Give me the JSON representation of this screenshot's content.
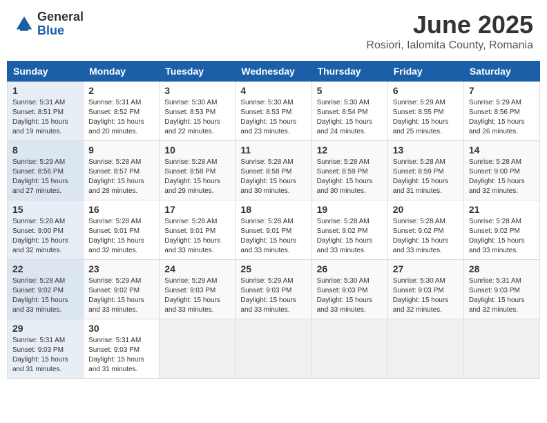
{
  "logo": {
    "general": "General",
    "blue": "Blue"
  },
  "title": "June 2025",
  "location": "Rosiori, Ialomita County, Romania",
  "weekdays": [
    "Sunday",
    "Monday",
    "Tuesday",
    "Wednesday",
    "Thursday",
    "Friday",
    "Saturday"
  ],
  "weeks": [
    [
      {
        "day": "1",
        "sunrise": "5:31 AM",
        "sunset": "8:51 PM",
        "daylight": "15 hours and 19 minutes."
      },
      {
        "day": "2",
        "sunrise": "5:31 AM",
        "sunset": "8:52 PM",
        "daylight": "15 hours and 20 minutes."
      },
      {
        "day": "3",
        "sunrise": "5:30 AM",
        "sunset": "8:53 PM",
        "daylight": "15 hours and 22 minutes."
      },
      {
        "day": "4",
        "sunrise": "5:30 AM",
        "sunset": "8:53 PM",
        "daylight": "15 hours and 23 minutes."
      },
      {
        "day": "5",
        "sunrise": "5:30 AM",
        "sunset": "8:54 PM",
        "daylight": "15 hours and 24 minutes."
      },
      {
        "day": "6",
        "sunrise": "5:29 AM",
        "sunset": "8:55 PM",
        "daylight": "15 hours and 25 minutes."
      },
      {
        "day": "7",
        "sunrise": "5:29 AM",
        "sunset": "8:56 PM",
        "daylight": "15 hours and 26 minutes."
      }
    ],
    [
      {
        "day": "8",
        "sunrise": "5:29 AM",
        "sunset": "8:56 PM",
        "daylight": "15 hours and 27 minutes."
      },
      {
        "day": "9",
        "sunrise": "5:28 AM",
        "sunset": "8:57 PM",
        "daylight": "15 hours and 28 minutes."
      },
      {
        "day": "10",
        "sunrise": "5:28 AM",
        "sunset": "8:58 PM",
        "daylight": "15 hours and 29 minutes."
      },
      {
        "day": "11",
        "sunrise": "5:28 AM",
        "sunset": "8:58 PM",
        "daylight": "15 hours and 30 minutes."
      },
      {
        "day": "12",
        "sunrise": "5:28 AM",
        "sunset": "8:59 PM",
        "daylight": "15 hours and 30 minutes."
      },
      {
        "day": "13",
        "sunrise": "5:28 AM",
        "sunset": "8:59 PM",
        "daylight": "15 hours and 31 minutes."
      },
      {
        "day": "14",
        "sunrise": "5:28 AM",
        "sunset": "9:00 PM",
        "daylight": "15 hours and 32 minutes."
      }
    ],
    [
      {
        "day": "15",
        "sunrise": "5:28 AM",
        "sunset": "9:00 PM",
        "daylight": "15 hours and 32 minutes."
      },
      {
        "day": "16",
        "sunrise": "5:28 AM",
        "sunset": "9:01 PM",
        "daylight": "15 hours and 32 minutes."
      },
      {
        "day": "17",
        "sunrise": "5:28 AM",
        "sunset": "9:01 PM",
        "daylight": "15 hours and 33 minutes."
      },
      {
        "day": "18",
        "sunrise": "5:28 AM",
        "sunset": "9:01 PM",
        "daylight": "15 hours and 33 minutes."
      },
      {
        "day": "19",
        "sunrise": "5:28 AM",
        "sunset": "9:02 PM",
        "daylight": "15 hours and 33 minutes."
      },
      {
        "day": "20",
        "sunrise": "5:28 AM",
        "sunset": "9:02 PM",
        "daylight": "15 hours and 33 minutes."
      },
      {
        "day": "21",
        "sunrise": "5:28 AM",
        "sunset": "9:02 PM",
        "daylight": "15 hours and 33 minutes."
      }
    ],
    [
      {
        "day": "22",
        "sunrise": "5:28 AM",
        "sunset": "9:02 PM",
        "daylight": "15 hours and 33 minutes."
      },
      {
        "day": "23",
        "sunrise": "5:29 AM",
        "sunset": "9:02 PM",
        "daylight": "15 hours and 33 minutes."
      },
      {
        "day": "24",
        "sunrise": "5:29 AM",
        "sunset": "9:03 PM",
        "daylight": "15 hours and 33 minutes."
      },
      {
        "day": "25",
        "sunrise": "5:29 AM",
        "sunset": "9:03 PM",
        "daylight": "15 hours and 33 minutes."
      },
      {
        "day": "26",
        "sunrise": "5:30 AM",
        "sunset": "9:03 PM",
        "daylight": "15 hours and 33 minutes."
      },
      {
        "day": "27",
        "sunrise": "5:30 AM",
        "sunset": "9:03 PM",
        "daylight": "15 hours and 32 minutes."
      },
      {
        "day": "28",
        "sunrise": "5:31 AM",
        "sunset": "9:03 PM",
        "daylight": "15 hours and 32 minutes."
      }
    ],
    [
      {
        "day": "29",
        "sunrise": "5:31 AM",
        "sunset": "9:03 PM",
        "daylight": "15 hours and 31 minutes."
      },
      {
        "day": "30",
        "sunrise": "5:31 AM",
        "sunset": "9:03 PM",
        "daylight": "15 hours and 31 minutes."
      },
      null,
      null,
      null,
      null,
      null
    ]
  ]
}
